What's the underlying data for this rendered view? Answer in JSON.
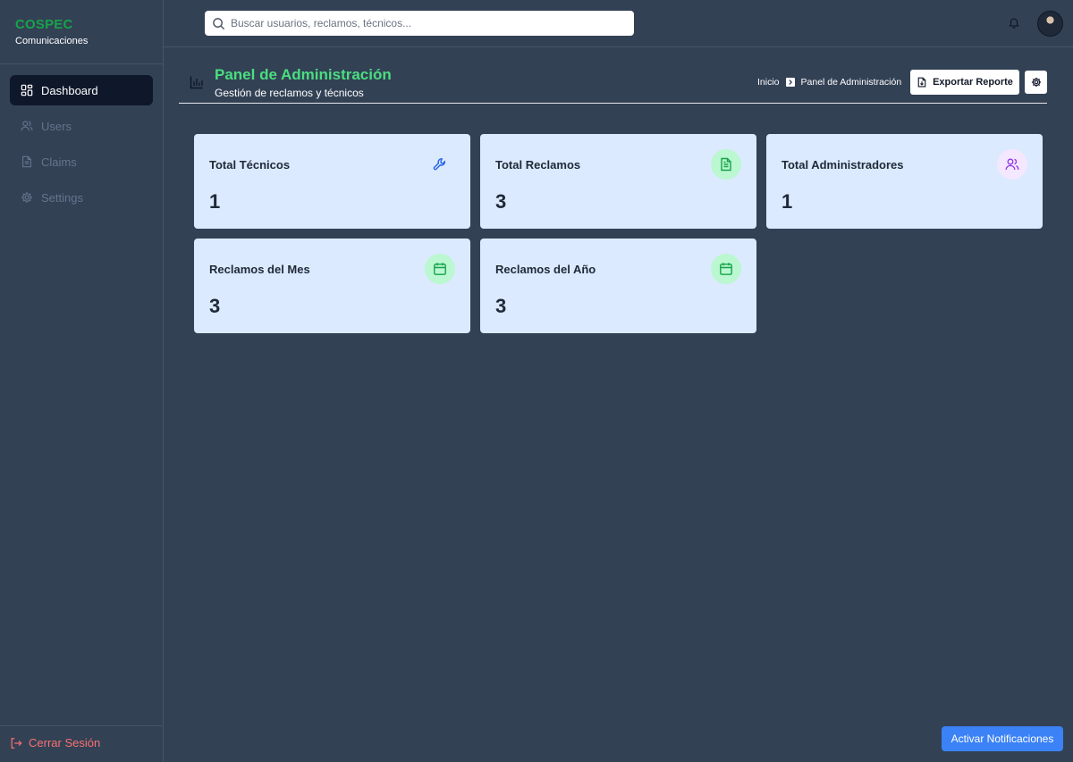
{
  "brand": {
    "name": "COSPEC",
    "subtitle": "Comunicaciones"
  },
  "sidebar": {
    "items": [
      {
        "label": "Dashboard",
        "icon": "dashboard-icon",
        "active": true
      },
      {
        "label": "Users",
        "icon": "users-icon",
        "active": false
      },
      {
        "label": "Claims",
        "icon": "file-icon",
        "active": false
      },
      {
        "label": "Settings",
        "icon": "gear-icon",
        "active": false
      }
    ],
    "logout_label": "Cerrar Sesión"
  },
  "search": {
    "placeholder": "Buscar usuarios, reclamos, técnicos..."
  },
  "header": {
    "title": "Panel de Administración",
    "subtitle": "Gestión de reclamos y técnicos",
    "breadcrumb": [
      "Inicio",
      "Panel de Administración"
    ],
    "export_label": "Exportar Reporte"
  },
  "cards": [
    {
      "title": "Total Técnicos",
      "value": "1",
      "icon": "wrench-icon",
      "color": "#2563eb",
      "bg": "transparent"
    },
    {
      "title": "Total Reclamos",
      "value": "3",
      "icon": "document-icon",
      "color": "#16a34a",
      "bg": "#bbf7d0"
    },
    {
      "title": "Total Administradores",
      "value": "1",
      "icon": "users-icon",
      "color": "#9333ea",
      "bg": "#f3e8ff"
    },
    {
      "title": "Reclamos del Mes",
      "value": "3",
      "icon": "calendar-icon",
      "color": "#16a34a",
      "bg": "#bbf7d0"
    },
    {
      "title": "Reclamos del Año",
      "value": "3",
      "icon": "calendar-icon",
      "color": "#16a34a",
      "bg": "#bbf7d0"
    }
  ],
  "notifications_button": "Activar Notificaciones",
  "colors": {
    "brand": "#16a34a",
    "accent_title": "#4ade80",
    "background": "#334155",
    "card_bg": "#dbeafe",
    "primary_button": "#3b82f6",
    "logout": "#f87171"
  }
}
